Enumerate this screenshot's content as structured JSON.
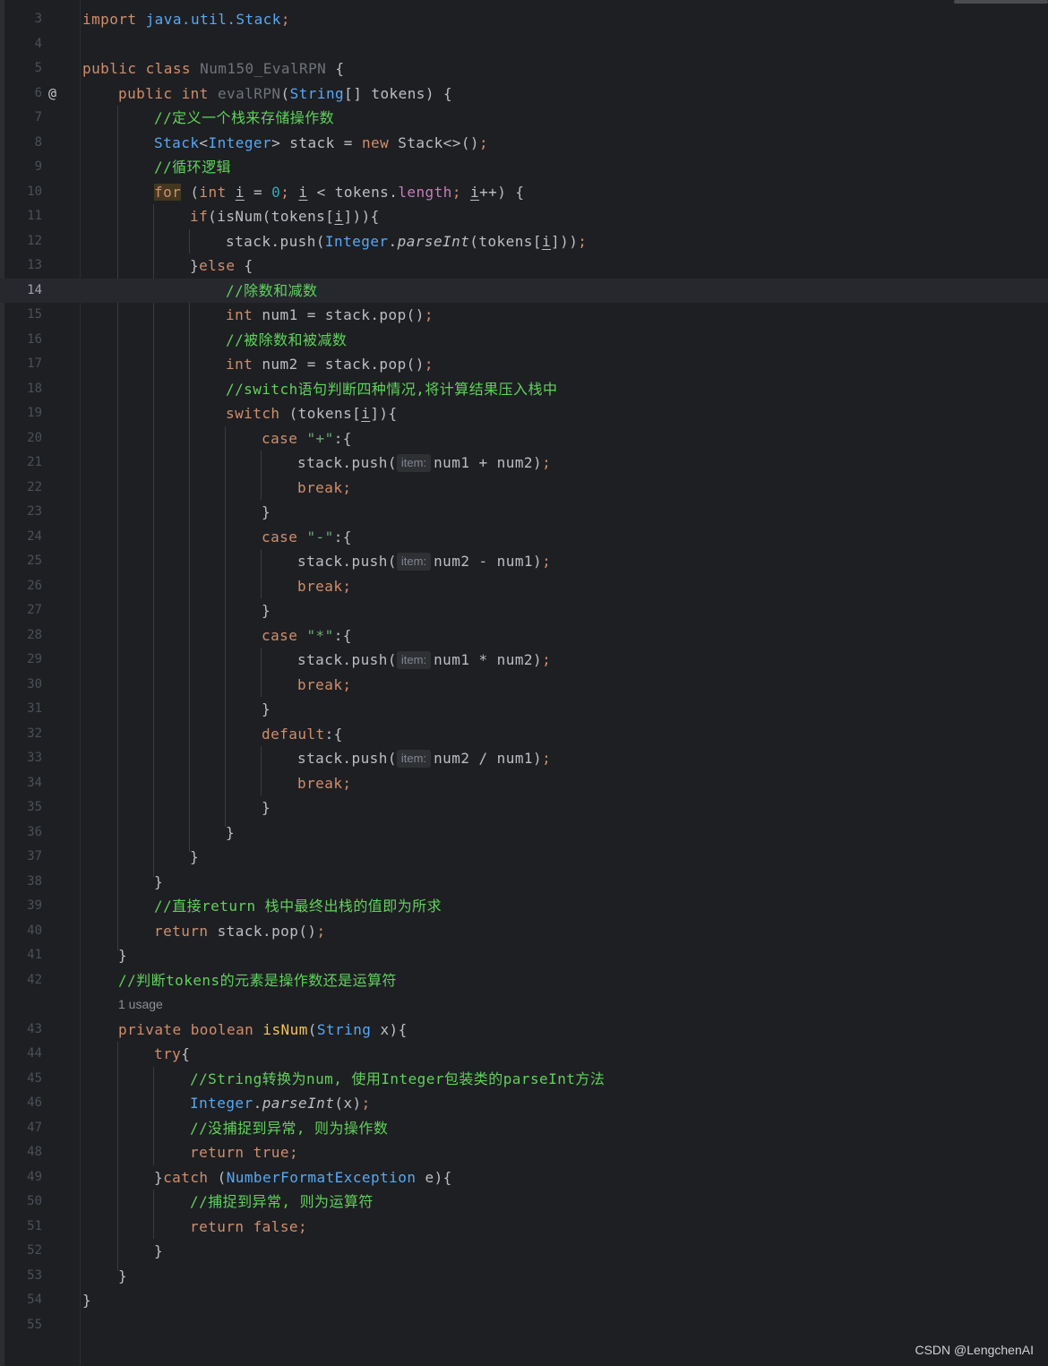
{
  "editor": {
    "gutter_marker": "@",
    "usage_hint": "1 usage",
    "param_hint": "item:",
    "watermark": "CSDN @LengchenAI",
    "lines": {
      "l3": {
        "num": "3",
        "import_kw": "import",
        "import_path": "java.util.Stack",
        "semi": ";"
      },
      "l4": {
        "num": "4"
      },
      "l5": {
        "num": "5",
        "kw1": "public",
        "kw2": "class",
        "cls": "Num150_EvalRPN",
        "rest": " {"
      },
      "l6": {
        "num": "6",
        "kw1": "public",
        "kw2": "int",
        "fn": "evalRPN",
        "p1": "(",
        "type": "String",
        "rest": "[] tokens) {"
      },
      "l7": {
        "num": "7",
        "comment": "//定义一个栈来存储操作数"
      },
      "l8": {
        "num": "8",
        "type1": "Stack",
        "lt": "<",
        "type2": "Integer",
        "mid": "> stack = ",
        "kw": "new",
        "rest": " Stack<>()",
        "semi": ";"
      },
      "l9": {
        "num": "9",
        "comment": "//循环逻辑"
      },
      "l10": {
        "num": "10",
        "kw_for": "for",
        "p1": " (",
        "kw_int": "int",
        "sp": " ",
        "i1": "i",
        "eq": " = ",
        "zero": "0",
        "semi1": ";",
        "sp2": " ",
        "i2": "i",
        "lt": " < tokens.",
        "length": "length",
        "semi2": ";",
        "sp3": " ",
        "i3": "i",
        "rest": "++) {"
      },
      "l11": {
        "num": "11",
        "kw_if": "if",
        "a": "(isNum(tokens[",
        "i": "i",
        "b": "])){"
      },
      "l12": {
        "num": "12",
        "a": "stack.push(",
        "type": "Integer",
        "dot": ".",
        "method": "parseInt",
        "b": "(tokens[",
        "i": "i",
        "c": "]))",
        "semi": ";"
      },
      "l13": {
        "num": "13",
        "a": "}",
        "kw": "else",
        "b": " {"
      },
      "l14": {
        "num": "14",
        "comment": "//除数和减数"
      },
      "l15": {
        "num": "15",
        "kw": "int",
        "rest": " num1 = stack.pop()",
        "semi": ";"
      },
      "l16": {
        "num": "16",
        "comment": "//被除数和被减数"
      },
      "l17": {
        "num": "17",
        "kw": "int",
        "rest": " num2 = stack.pop()",
        "semi": ";"
      },
      "l18": {
        "num": "18",
        "comment": "//switch语句判断四种情况,将计算结果压入栈中"
      },
      "l19": {
        "num": "19",
        "kw": "switch",
        "a": " (tokens[",
        "i": "i",
        "b": "]){"
      },
      "l20": {
        "num": "20",
        "kw": "case",
        "sp": " ",
        "str": "\"+\"",
        "rest": ":{"
      },
      "l21": {
        "num": "21",
        "a": "stack.push(",
        "b": "num1 + num2)",
        "semi": ";"
      },
      "l22": {
        "num": "22",
        "kw": "break",
        "semi": ";"
      },
      "l23": {
        "num": "23",
        "brace": "}"
      },
      "l24": {
        "num": "24",
        "kw": "case",
        "sp": " ",
        "str": "\"-\"",
        "rest": ":{"
      },
      "l25": {
        "num": "25",
        "a": "stack.push(",
        "b": "num2 - num1)",
        "semi": ";"
      },
      "l26": {
        "num": "26",
        "kw": "break",
        "semi": ";"
      },
      "l27": {
        "num": "27",
        "brace": "}"
      },
      "l28": {
        "num": "28",
        "kw": "case",
        "sp": " ",
        "str": "\"*\"",
        "rest": ":{"
      },
      "l29": {
        "num": "29",
        "a": "stack.push(",
        "b": "num1 * num2)",
        "semi": ";"
      },
      "l30": {
        "num": "30",
        "kw": "break",
        "semi": ";"
      },
      "l31": {
        "num": "31",
        "brace": "}"
      },
      "l32": {
        "num": "32",
        "kw": "default",
        "rest": ":{"
      },
      "l33": {
        "num": "33",
        "a": "stack.push(",
        "b": "num2 / num1)",
        "semi": ";"
      },
      "l34": {
        "num": "34",
        "kw": "break",
        "semi": ";"
      },
      "l35": {
        "num": "35",
        "brace": "}"
      },
      "l36": {
        "num": "36",
        "brace": "}"
      },
      "l37": {
        "num": "37",
        "brace": "}"
      },
      "l38": {
        "num": "38",
        "brace": "}"
      },
      "l39": {
        "num": "39",
        "comment": "//直接return 栈中最终出栈的值即为所求"
      },
      "l40": {
        "num": "40",
        "kw": "return",
        "rest": " stack.pop()",
        "semi": ";"
      },
      "l41": {
        "num": "41",
        "brace": "}"
      },
      "l42": {
        "num": "42",
        "comment": "//判断tokens的元素是操作数还是运算符"
      },
      "l43": {
        "num": "43",
        "kw1": "private",
        "kw2": "boolean",
        "fn": "isNum",
        "p1": "(",
        "type": "String",
        "rest": " x){"
      },
      "l44": {
        "num": "44",
        "kw": "try",
        "rest": "{"
      },
      "l45": {
        "num": "45",
        "comment": "//String转换为num, 使用Integer包装类的parseInt方法"
      },
      "l46": {
        "num": "46",
        "type": "Integer",
        "dot": ".",
        "method": "parseInt",
        "rest": "(x)",
        "semi": ";"
      },
      "l47": {
        "num": "47",
        "comment": "//没捕捉到异常, 则为操作数"
      },
      "l48": {
        "num": "48",
        "kw": "return",
        "sp": " ",
        "kw2": "true",
        "semi": ";"
      },
      "l49": {
        "num": "49",
        "a": "}",
        "kw": "catch",
        "b": " (",
        "type": "NumberFormatException",
        "rest": " e){"
      },
      "l50": {
        "num": "50",
        "comment": "//捕捉到异常, 则为运算符"
      },
      "l51": {
        "num": "51",
        "kw": "return",
        "sp": " ",
        "kw2": "false",
        "semi": ";"
      },
      "l52": {
        "num": "52",
        "brace": "}"
      },
      "l53": {
        "num": "53",
        "brace": "}"
      },
      "l54": {
        "num": "54",
        "brace": "}"
      },
      "l55": {
        "num": "55"
      }
    }
  }
}
